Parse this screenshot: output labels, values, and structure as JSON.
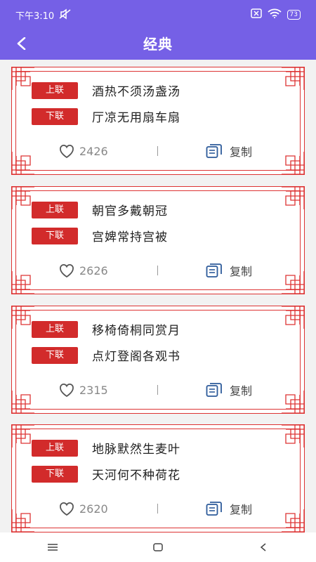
{
  "status": {
    "time": "下午3:10",
    "battery": "73"
  },
  "header": {
    "title": "经典"
  },
  "labels": {
    "upper": "上联",
    "lower": "下联",
    "copy": "复制"
  },
  "couplets": [
    {
      "upper": "酒热不须汤盏汤",
      "lower": "厅凉无用扇车扇",
      "likes": "2426"
    },
    {
      "upper": "朝官多戴朝冠",
      "lower": "宫婢常持宫被",
      "likes": "2626"
    },
    {
      "upper": "移椅倚桐同赏月",
      "lower": "点灯登阁各观书",
      "likes": "2315"
    },
    {
      "upper": "地脉默然生麦叶",
      "lower": "天河何不种荷花",
      "likes": "2620"
    }
  ],
  "colors": {
    "header": "#7560e6",
    "accent": "#d22b2b",
    "copy_icon": "#2c5a9a"
  }
}
